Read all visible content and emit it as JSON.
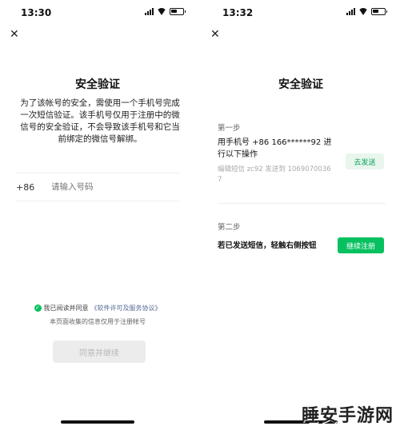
{
  "left": {
    "status_time": "13:30",
    "close_icon": "close-icon",
    "title": "安全验证",
    "description": "为了该帐号的安全，需使用一个手机号完成一次短信验证。该手机号仅用于注册中的微信号的安全验证，不会导致该手机号和它当前绑定的微信号解绑。",
    "country_code": "+86",
    "phone_placeholder": "请输入号码",
    "agree_prefix": "我已阅读并同意",
    "agree_link": "《软件许可及服务协议》",
    "note": "本页面收集的信息仅用于注册帐号",
    "agree_button": "同意并继续"
  },
  "right": {
    "status_time": "13:32",
    "close_icon": "close-icon",
    "title": "安全验证",
    "step1_label": "第一步",
    "step1_text": "用手机号 +86 166******92 进行以下操作",
    "step1_sub": "编辑短信 zc92 发送到 10690700367",
    "send_button": "去发送",
    "step2_label": "第二步",
    "step2_text": "若已发送短信，轻触右侧按钮",
    "continue_button": "继续注册"
  },
  "watermark": "睡安手游网",
  "colors": {
    "accent": "#07c160",
    "link": "#576b95",
    "disabled_bg": "#ececec"
  }
}
